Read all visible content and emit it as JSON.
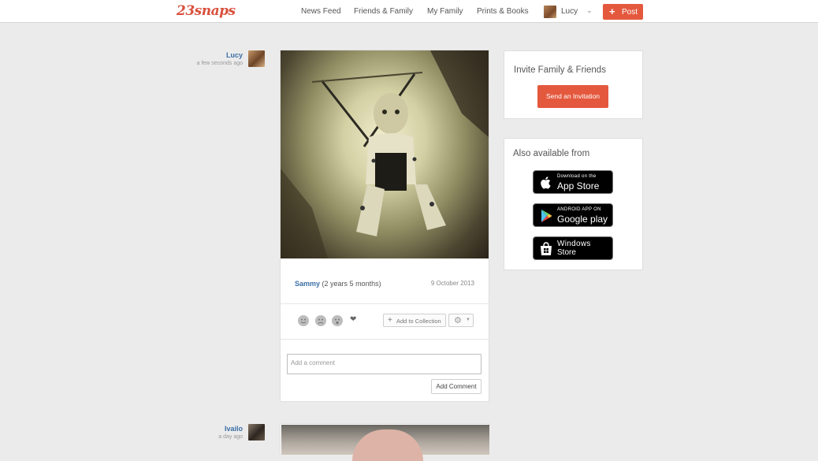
{
  "header": {
    "logo": "23snaps",
    "nav": [
      "News Feed",
      "Friends & Family",
      "My Family",
      "Prints & Books"
    ],
    "user_name": "Lucy",
    "post_label": "Post"
  },
  "posts": [
    {
      "author": "Lucy",
      "time": "a few seconds ago",
      "child": "Sammy",
      "age": "(2 years 5 months)",
      "date": "9 October 2013",
      "add_to_collection": "Add to Collection",
      "comment_placeholder": "Add a comment",
      "add_comment_label": "Add Comment"
    },
    {
      "author": "Ivailo",
      "time": "a day ago"
    }
  ],
  "sidebar": {
    "invite_title": "Invite Family & Friends",
    "invite_button": "Send an Invitation",
    "available_title": "Also available from",
    "stores": [
      {
        "small": "Download on the",
        "big": "App Store",
        "icon": "apple-icon"
      },
      {
        "small": "ANDROID APP ON",
        "big": "Google play",
        "icon": "google-play-icon"
      },
      {
        "small": "Windows",
        "big": "Store",
        "icon": "windows-store-icon"
      }
    ]
  },
  "colors": {
    "accent": "#e4583d",
    "link": "#3c6fa5",
    "background": "#ebebeb"
  }
}
